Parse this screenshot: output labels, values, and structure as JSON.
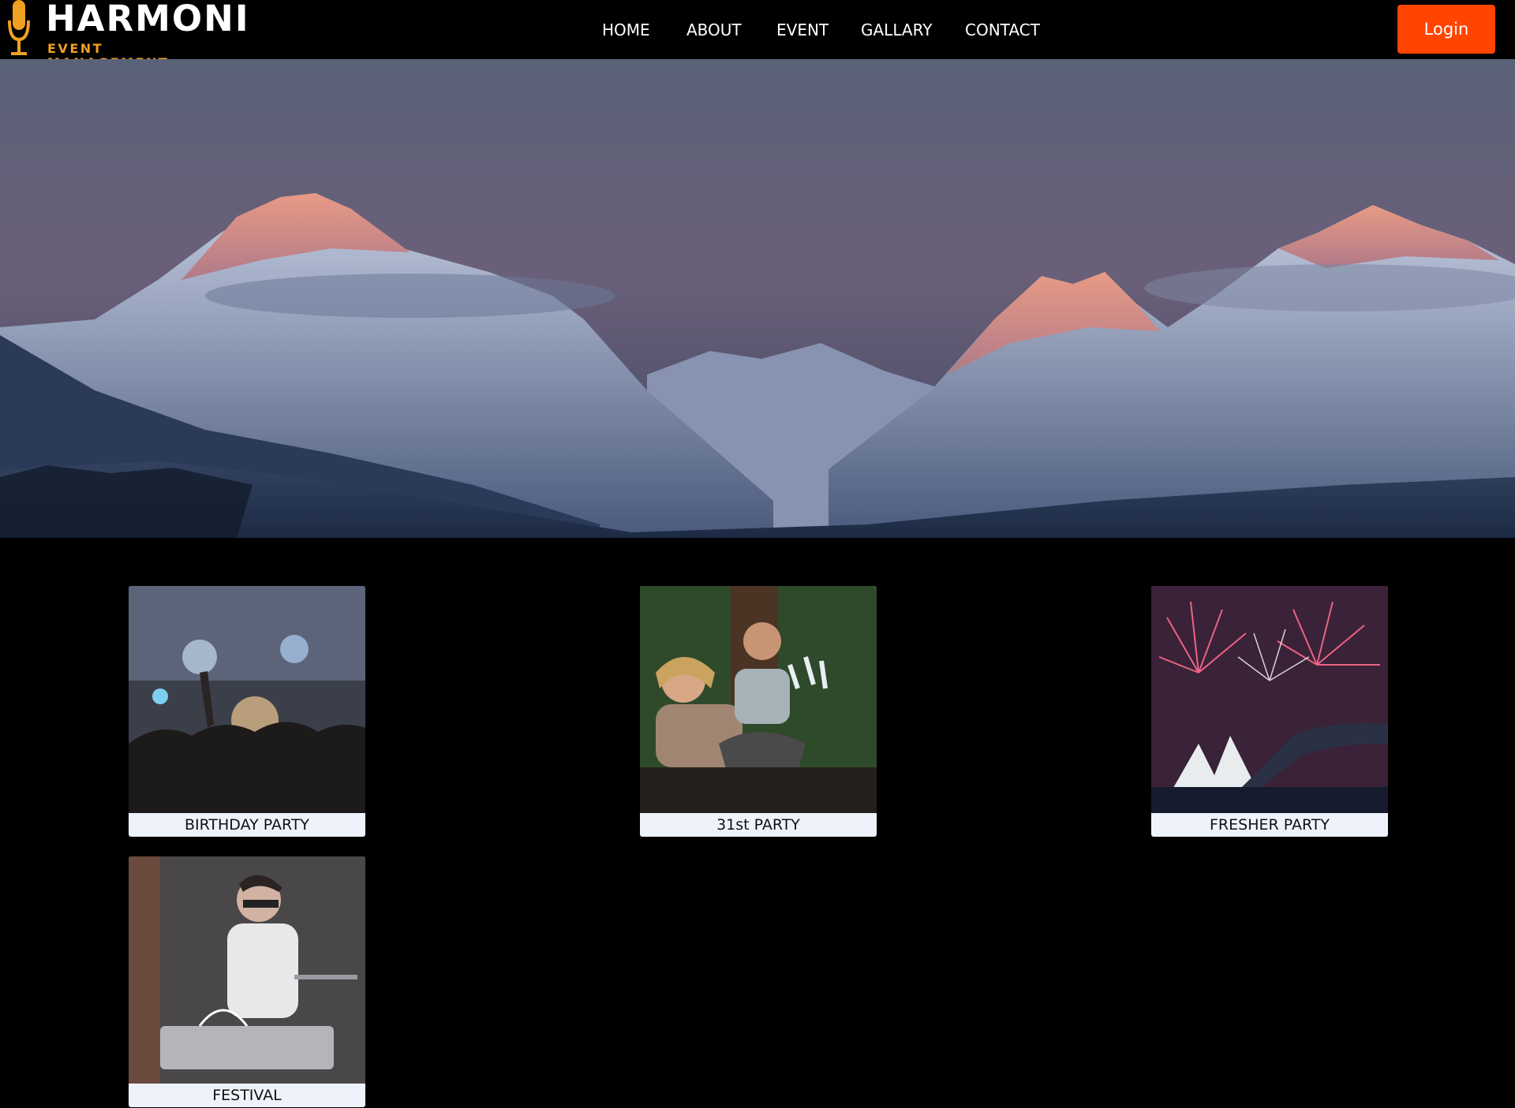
{
  "brand": {
    "name": "HARMONI",
    "tagline": "EVENT MANAGEMENT"
  },
  "nav": {
    "items": [
      {
        "label": "HOME"
      },
      {
        "label": "ABOUT"
      },
      {
        "label": "EVENT"
      },
      {
        "label": "GALLARY"
      },
      {
        "label": "CONTACT"
      }
    ],
    "login_label": "Login"
  },
  "colors": {
    "accent": "#ff4500",
    "logo_orange": "#f0a020",
    "background": "#000000",
    "card_caption_bg": "#eef3fb"
  },
  "events": [
    {
      "title": "BIRTHDAY PARTY",
      "image": "concert-crowd"
    },
    {
      "title": "31st PARTY",
      "image": "friends-toasting"
    },
    {
      "title": "FRESHER PARTY",
      "image": "fireworks-opera-house"
    },
    {
      "title": "FESTIVAL",
      "image": "drummer"
    }
  ]
}
